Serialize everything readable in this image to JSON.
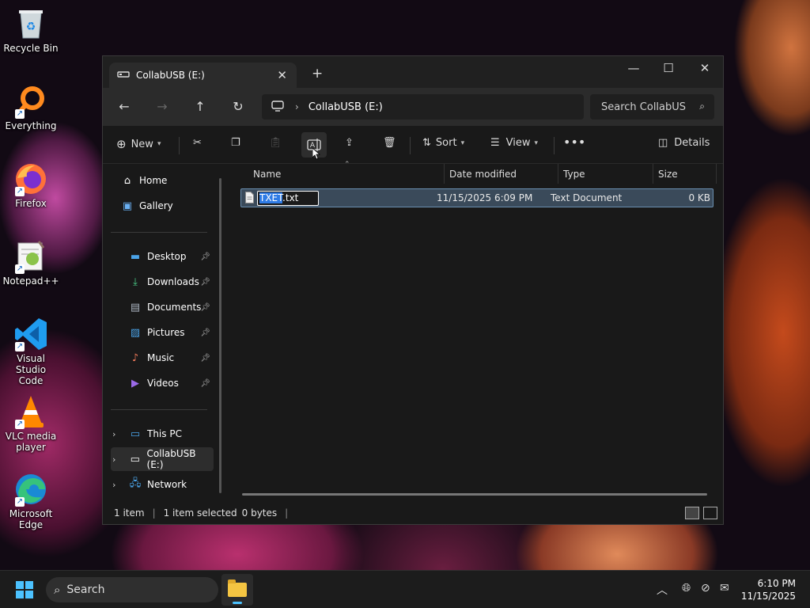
{
  "desktop": {
    "icons": [
      {
        "label": "Recycle Bin"
      },
      {
        "label": "Everything"
      },
      {
        "label": "Firefox"
      },
      {
        "label": "Notepad++"
      },
      {
        "label": "Visual Studio Code"
      },
      {
        "label": "VLC media player"
      },
      {
        "label": "Microsoft Edge"
      }
    ]
  },
  "window": {
    "tab_title": "CollabUSB (E:)",
    "address": {
      "crumb": "CollabUSB (E:)"
    },
    "search_placeholder": "Search CollabUS",
    "toolbar": {
      "new_label": "New",
      "sort_label": "Sort",
      "view_label": "View",
      "details_label": "Details"
    },
    "sidebar": {
      "home": "Home",
      "gallery": "Gallery",
      "desktop": "Desktop",
      "downloads": "Downloads",
      "documents": "Documents",
      "pictures": "Pictures",
      "music": "Music",
      "videos": "Videos",
      "this_pc": "This PC",
      "collabusb": "CollabUSB (E:)",
      "network": "Network"
    },
    "columns": {
      "name": "Name",
      "date": "Date modified",
      "type": "Type",
      "size": "Size"
    },
    "files": [
      {
        "name_selected": "TXET",
        "name_rest": ".txt",
        "date": "11/15/2025 6:09 PM",
        "type": "Text Document",
        "size": "0 KB"
      }
    ],
    "status": {
      "count": "1 item",
      "selection": "1 item selected",
      "size": "0 bytes"
    }
  },
  "taskbar": {
    "search_label": "Search",
    "time": "6:10 PM",
    "date": "11/15/2025"
  }
}
